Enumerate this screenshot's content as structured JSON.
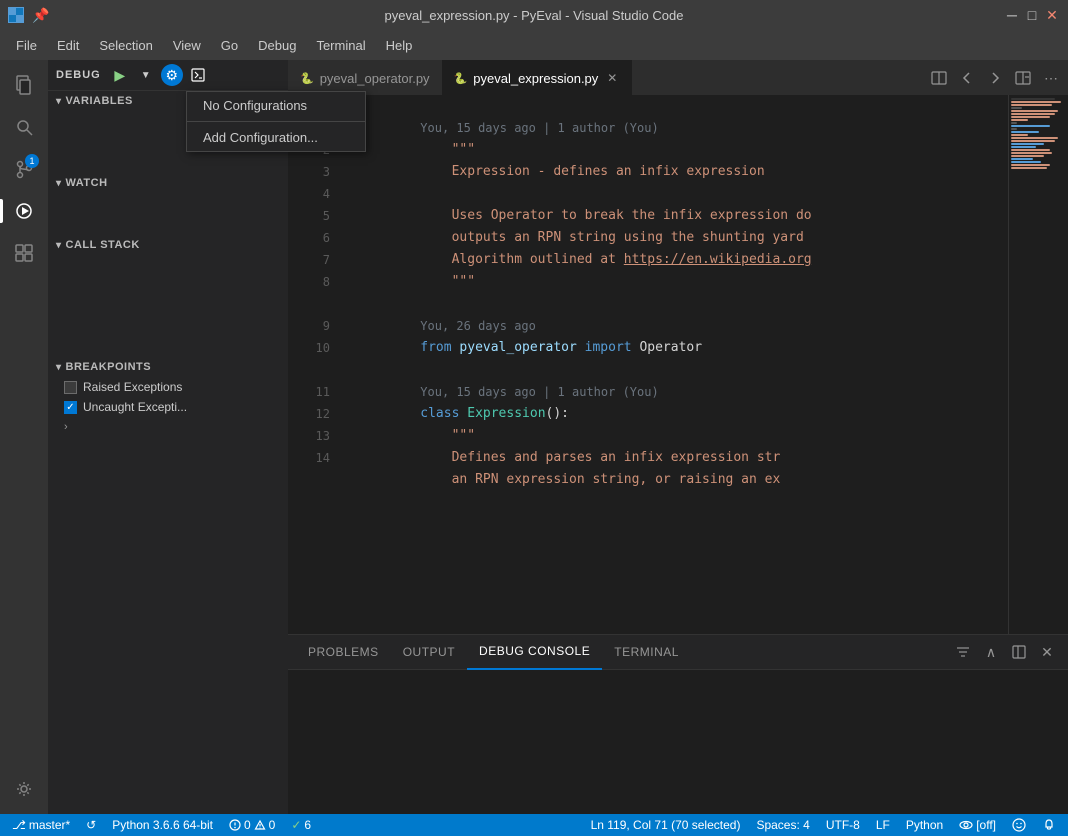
{
  "titleBar": {
    "title": "pyeval_expression.py - PyEval - Visual Studio Code",
    "appIcon": "VS",
    "pinIcon": "📌",
    "btnMinimize": "─",
    "btnMaximize": "□",
    "btnClose": "✕"
  },
  "menuBar": {
    "items": [
      "File",
      "Edit",
      "Selection",
      "View",
      "Go",
      "Debug",
      "Terminal",
      "Help"
    ]
  },
  "activityBar": {
    "icons": [
      {
        "name": "explorer-icon",
        "symbol": "⎘",
        "active": false
      },
      {
        "name": "search-icon",
        "symbol": "🔍",
        "active": false
      },
      {
        "name": "source-control-icon",
        "symbol": "⑂",
        "active": false,
        "badge": "1"
      },
      {
        "name": "debug-icon",
        "symbol": "⬤",
        "active": true
      },
      {
        "name": "extensions-icon",
        "symbol": "⊞",
        "active": false
      },
      {
        "name": "remote-icon",
        "symbol": "◎",
        "active": false
      }
    ],
    "bottomIcons": [
      {
        "name": "account-icon",
        "symbol": "⚙"
      }
    ]
  },
  "sidebar": {
    "debugLabel": "DEBUG",
    "playBtn": "▶",
    "dropdownArrow": "▼",
    "gearBtn": "⚙",
    "terminalBtn": "⧉",
    "sections": {
      "variables": {
        "label": "VARIABLES"
      },
      "watch": {
        "label": "WATCH"
      },
      "callStack": {
        "label": "CALL STACK"
      },
      "breakpoints": {
        "label": "BREAKPOINTS"
      }
    },
    "breakpointItems": [
      {
        "label": "Raised Exceptions",
        "checked": false
      },
      {
        "label": "Uncaught Excepti...",
        "checked": true
      }
    ]
  },
  "dropdown": {
    "items": [
      {
        "label": "No Configurations",
        "selected": false
      },
      {
        "label": "Add Configuration...",
        "selected": false
      }
    ]
  },
  "tabs": {
    "items": [
      {
        "label": "pyeval_operator.py",
        "active": false,
        "icon": "py",
        "closable": false
      },
      {
        "label": "pyeval_expression.py",
        "active": true,
        "icon": "py",
        "closable": true
      }
    ],
    "actions": [
      "⇤",
      "⇥",
      "⊞",
      "⋯"
    ]
  },
  "codeEditor": {
    "lines": [
      {
        "num": "",
        "blame": "You, 15 days ago | 1 author (You)",
        "content": "",
        "type": "blame"
      },
      {
        "num": "1",
        "content": "    \"\"\"",
        "type": "string"
      },
      {
        "num": "2",
        "content": "    Expression - defines an infix expression",
        "type": "string-orange"
      },
      {
        "num": "3",
        "content": "",
        "type": "blank"
      },
      {
        "num": "4",
        "content": "    Uses Operator to break the infix expression do",
        "type": "string-orange"
      },
      {
        "num": "5",
        "content": "    outputs an RPN string using the shunting yard",
        "type": "string-orange"
      },
      {
        "num": "6",
        "content": "    Algorithm outlined at https://en.wikipedia.org",
        "type": "string-link"
      },
      {
        "num": "7",
        "content": "    \"\"\"",
        "type": "string"
      },
      {
        "num": "8",
        "content": "",
        "type": "blank"
      },
      {
        "num": "",
        "blame": "You, 26 days ago",
        "content": "",
        "type": "blame"
      },
      {
        "num": "9",
        "content": "from pyeval_operator import Operator",
        "type": "import"
      },
      {
        "num": "10",
        "content": "",
        "type": "blank"
      },
      {
        "num": "",
        "blame": "You, 15 days ago | 1 author (You)",
        "content": "",
        "type": "blame"
      },
      {
        "num": "11",
        "content": "class Expression():",
        "type": "class"
      },
      {
        "num": "12",
        "content": "    \"\"\"",
        "type": "string"
      },
      {
        "num": "13",
        "content": "    Defines and parses an infix expression str",
        "type": "string-orange"
      },
      {
        "num": "14",
        "content": "    an RPN expression string, or raising an ex",
        "type": "string-orange"
      }
    ]
  },
  "bottomPanel": {
    "tabs": [
      "PROBLEMS",
      "OUTPUT",
      "DEBUG CONSOLE",
      "TERMINAL"
    ],
    "activeTab": "DEBUG CONSOLE",
    "actions": [
      "≡",
      "∧",
      "⧉",
      "✕"
    ]
  },
  "statusBar": {
    "branch": "master*",
    "sync": "↺",
    "python": "Python 3.6.6 64-bit",
    "errors": "0",
    "warnings": "0",
    "checks": "6",
    "position": "Ln 119, Col 71 (70 selected)",
    "spaces": "Spaces: 4",
    "encoding": "UTF-8",
    "lineEnding": "LF",
    "language": "Python",
    "eye": "👁",
    "offLabel": "[off]",
    "smiley": "😊",
    "bell": "🔔"
  }
}
